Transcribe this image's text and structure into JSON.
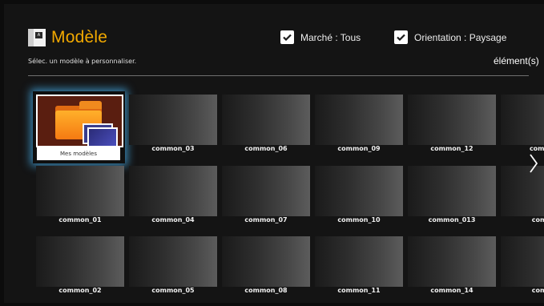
{
  "header": {
    "title": "Modèle",
    "subtitle": "Sélec. un modèle à personnaliser.",
    "filter_market": "Marché : Tous",
    "filter_orientation": "Orientation : Paysage",
    "count": "élément(s)"
  },
  "focused_item": {
    "label": "Mes modèles",
    "icon": "folder-icon"
  },
  "templates": [
    [
      "common_03",
      "common_06",
      "common_09",
      "common_12",
      "common"
    ],
    [
      "common_01",
      "common_04",
      "common_07",
      "common_10",
      "common_013",
      "commo"
    ],
    [
      "common_02",
      "common_05",
      "common_08",
      "common_11",
      "common_14",
      "commo"
    ]
  ],
  "colors": {
    "title": "#f2a900",
    "focus_glow": "#46aae6"
  },
  "nav": {
    "next_icon": "chevron-right-icon"
  }
}
